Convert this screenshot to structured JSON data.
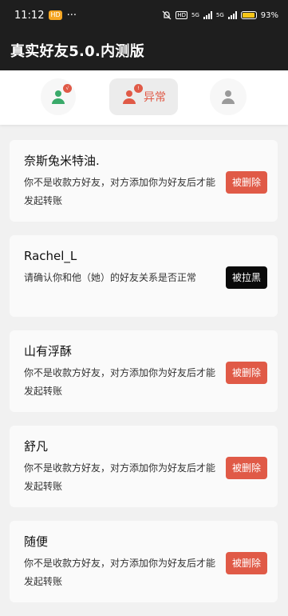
{
  "status_bar": {
    "time": "11:12",
    "badge": "HD",
    "dots": "···",
    "signal1": "5G",
    "signal2": "5G",
    "battery": "93%"
  },
  "header": {
    "title": "真实好友5.0.内测版"
  },
  "tabs": [
    {
      "label": "",
      "icon": "user-check-icon",
      "badge": "√"
    },
    {
      "label": "异常",
      "icon": "user-warning-icon",
      "badge": "!"
    },
    {
      "label": "",
      "icon": "user-icon"
    }
  ],
  "colors": {
    "accent": "#e05a47",
    "header_bg": "#1e1e1e",
    "blocked": "#0a0a0a"
  },
  "cards": [
    {
      "name": "奈斯兔米特油.",
      "message": "你不是收款方好友，对方添加你为好友后才能发起转账",
      "status": "被删除"
    },
    {
      "name": "Rachel_L",
      "message": "请确认你和他（她）的好友关系是否正常",
      "status": "被拉黑"
    },
    {
      "name": "山有浮酥",
      "message": "你不是收款方好友，对方添加你为好友后才能发起转账",
      "status": "被删除"
    },
    {
      "name": "舒凡",
      "message": "你不是收款方好友，对方添加你为好友后才能发起转账",
      "status": "被删除"
    },
    {
      "name": "随便",
      "message": "你不是收款方好友，对方添加你为好友后才能发起转账",
      "status": "被删除"
    }
  ]
}
